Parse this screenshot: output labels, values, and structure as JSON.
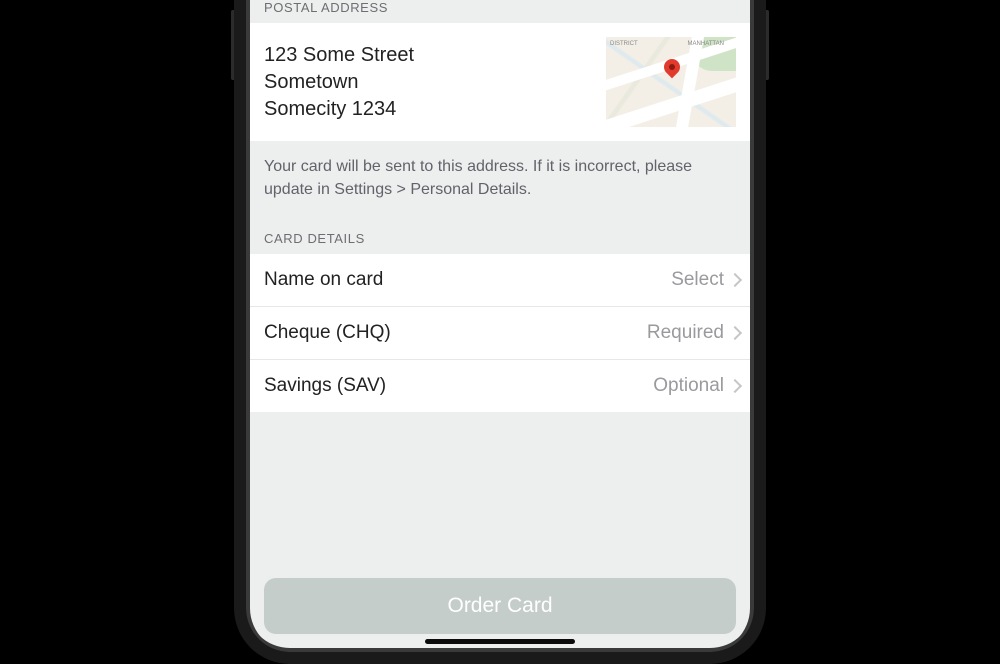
{
  "sections": {
    "postal_header": "POSTAL ADDRESS",
    "card_header": "CARD DETAILS"
  },
  "address": {
    "line1": "123 Some Street",
    "line2": "Sometown",
    "line3": "Somecity 1234"
  },
  "note": "Your card will be sent to this address. If it is incorrect, please update in Settings > Personal Details.",
  "rows": {
    "name_label": "Name on card",
    "name_value": "Select",
    "cheque_label": "Cheque (CHQ)",
    "cheque_value": "Required",
    "savings_label": "Savings (SAV)",
    "savings_value": "Optional"
  },
  "cta": "Order Card"
}
